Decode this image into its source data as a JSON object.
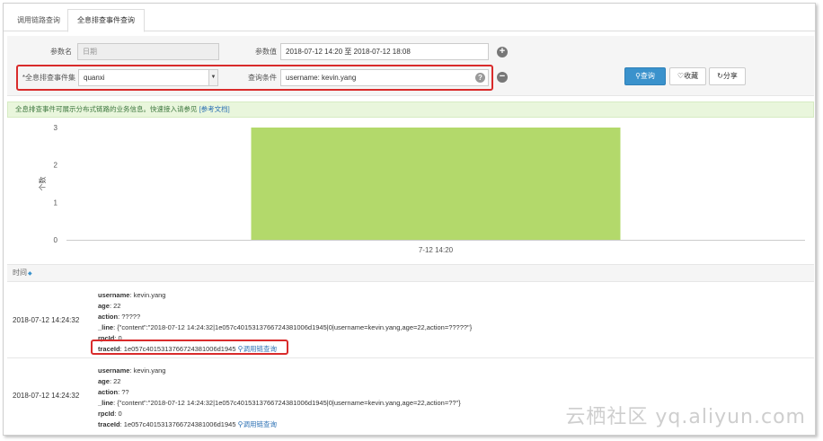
{
  "tabs": [
    {
      "label": "调用链路查询"
    },
    {
      "label": "全息排查事件查询"
    }
  ],
  "filters": {
    "param_name_label": "参数名",
    "param_name_placeholder": "日期",
    "param_value_label": "参数值",
    "date_start": "2018-07-12 14:20",
    "date_sep": "至",
    "date_end": "2018-07-12 18:08",
    "event_set_label": "*全息排查事件集",
    "event_set_value": "quanxi",
    "condition_label": "查询条件",
    "condition_value": "username: kevin.yang",
    "add_icon": "plus-icon",
    "remove_icon": "minus-icon",
    "help_icon": "question-icon"
  },
  "actions": {
    "search_label": "查询",
    "favorite_label": "收藏",
    "share_label": "分享"
  },
  "notice": {
    "text": "全息排查事件可展示分布式链路的业务信息。快速接入请参见 ",
    "link": "[参考文档]"
  },
  "chart_data": {
    "type": "bar",
    "categories": [
      "7-12 14:20"
    ],
    "values": [
      3
    ],
    "ylabel": "个数",
    "ylim": [
      0,
      3
    ],
    "yticks": [
      "0",
      "1",
      "2",
      "3"
    ],
    "bar_color": "#b3d96b",
    "grid": false
  },
  "table": {
    "header_time": "时间",
    "rows": [
      {
        "time": "2018-07-12 14:24:32",
        "username_k": "username",
        "username_v": "kevin.yang",
        "age_k": "age",
        "age_v": "22",
        "action_k": "action",
        "action_v": "?????",
        "line_k": "_line",
        "line_v": "{\"content\":\"2018-07-12 14:24:32|1e057c4015313766724381006d1945|0|username=kevin.yang,age=22,action=?????\"}",
        "rpcid_k": "rpcId",
        "rpcid_v": "0",
        "traceid_k": "traceId",
        "traceid_v": "1e057c4015313766724381006d1945",
        "link_label": "调用链查询"
      },
      {
        "time": "2018-07-12 14:24:32",
        "username_k": "username",
        "username_v": "kevin.yang",
        "age_k": "age",
        "age_v": "22",
        "action_k": "action",
        "action_v": "??",
        "line_k": "_line",
        "line_v": "{\"content\":\"2018-07-12 14:24:32|1e057c4015313766724381006d1945|0|username=kevin.yang,age=22,action=??\"}",
        "rpcid_k": "rpcId",
        "rpcid_v": "0",
        "traceid_k": "traceId",
        "traceid_v": "1e057c4015313766724381006d1945",
        "link_label": "调用链查询"
      }
    ]
  },
  "watermark": "云栖社区 yq.aliyun.com",
  "colors": {
    "primary": "#3a92cc",
    "highlight_border": "#d92b2b",
    "notice_bg": "#e9f6dc",
    "bar": "#b3d96b"
  }
}
